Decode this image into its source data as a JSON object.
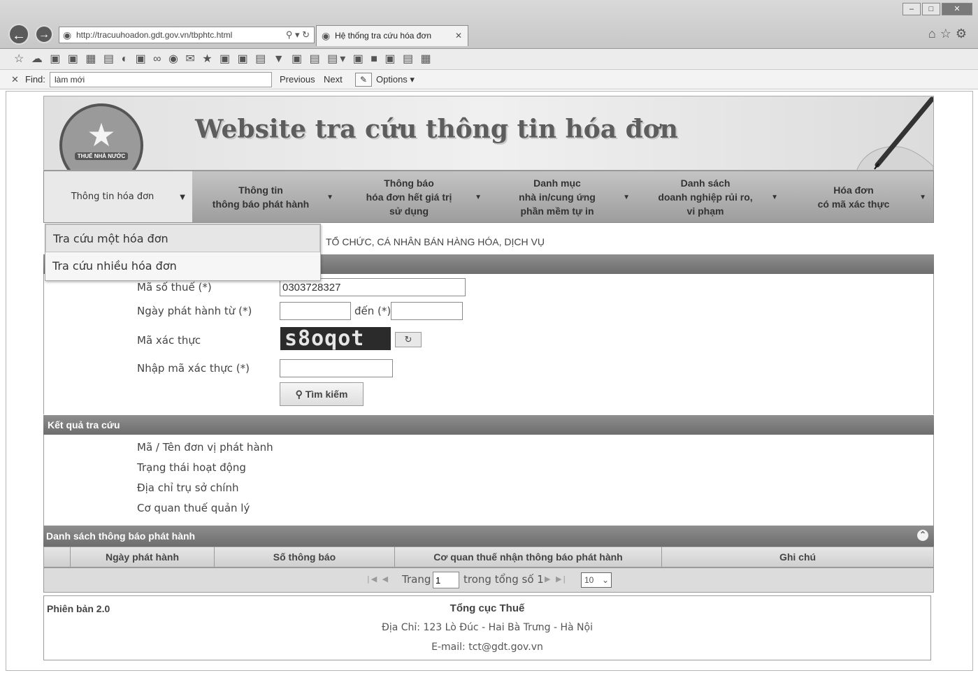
{
  "browser": {
    "url": "http://tracuuhoadon.gdt.gov.vn/tbphtc.html",
    "tab_title": "Hệ thống tra cứu hóa đơn",
    "find_label": "Find:",
    "find_value": "làm mới",
    "find_previous": "Previous",
    "find_next": "Next",
    "find_options": "Options"
  },
  "banner": {
    "title": "Website tra cứu thông tin hóa đơn",
    "logo_text": "THUẾ NHÀ NƯỚC"
  },
  "menu": [
    {
      "label": "Thông tin hóa đơn"
    },
    {
      "label": "Thông tin\nthông báo phát hành"
    },
    {
      "label": "Thông báo\nhóa đơn hết giá trị\nsử dụng"
    },
    {
      "label": "Danh mục\nnhà in/cung ứng\nphần mềm tự in"
    },
    {
      "label": "Danh sách\ndoanh nghiệp rủi ro,\nvi phạm"
    },
    {
      "label": "Hóa đơn\ncó mã xác thực"
    }
  ],
  "dropdown": {
    "items": [
      "Tra cứu một hóa đơn",
      "Tra cứu nhiều hóa đơn"
    ]
  },
  "breadcrumb": "TỔ CHỨC, CÁ NHÂN BÁN HÀNG HÓA, DỊCH VỤ",
  "form": {
    "tax_code_label": "Mã số thuế (*)",
    "tax_code_value": "0303728327",
    "date_from_label": "Ngày phát hành từ (*)",
    "date_to_label": "đến (*)",
    "date_from_value": "",
    "date_to_value": "",
    "captcha_label": "Mã xác thực",
    "captcha_text": "s8oqot",
    "captcha_input_label": "Nhập mã xác thực (*)",
    "captcha_input_value": "",
    "search_button": "Tìm kiếm"
  },
  "results": {
    "title": "Kết quả tra cứu",
    "fields": [
      "Mã / Tên đơn vị phát hành",
      "Trạng thái hoạt động",
      "Địa chỉ trụ sở chính",
      "Cơ quan thuế quản lý"
    ]
  },
  "table": {
    "title": "Danh sách thông báo phát hành",
    "columns": [
      "",
      "Ngày phát hành",
      "Số thông báo",
      "Cơ quan thuế nhận thông báo phát hành",
      "Ghi chú"
    ],
    "pager_prefix": "Trang",
    "page_value": "1",
    "pager_total": "trong tổng số 1",
    "page_size": "10"
  },
  "footer": {
    "version": "Phiên bản 2.0",
    "org": "Tổng cục Thuế",
    "address": "Địa Chỉ: 123 Lò Đúc - Hai Bà Trưng - Hà Nội",
    "email": "E-mail: tct@gdt.gov.vn"
  }
}
